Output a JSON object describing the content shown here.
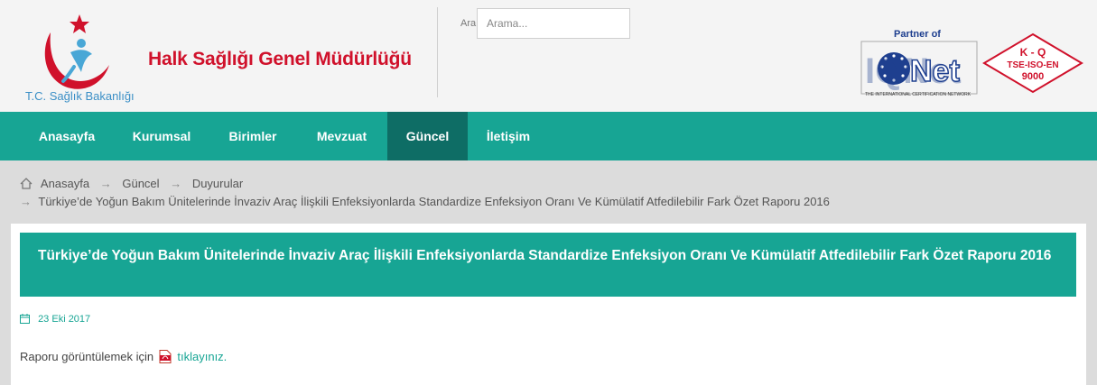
{
  "header": {
    "org_name": "Halk Sağlığı Genel Müdürlüğü",
    "ministry": "T.C. Sağlık Bakanlığı",
    "search": {
      "label": "Ara",
      "placeholder": "Arama..."
    },
    "badges": {
      "partner_label": "Partner of",
      "iqnet": "IQNet",
      "iqnet_sub": "THE INTERNATIONAL CERTIFICATION NETWORK",
      "kq_line1": "K - Q",
      "kq_line2": "TSE-ISO-EN",
      "kq_line3": "9000"
    },
    "colors": {
      "brand_red": "#d0112b",
      "teal": "#17a594",
      "teal_dark": "#0e6d65"
    }
  },
  "nav": {
    "items": [
      {
        "label": "Anasayfa"
      },
      {
        "label": "Kurumsal"
      },
      {
        "label": "Birimler"
      },
      {
        "label": "Mevzuat"
      },
      {
        "label": "Güncel",
        "active": true
      },
      {
        "label": "İletişim"
      }
    ]
  },
  "breadcrumb": {
    "items": [
      "Anasayfa",
      "Güncel",
      "Duyurular"
    ],
    "current": "Türkiye’de Yoğun Bakım Ünitelerinde İnvaziv Araç İlişkili Enfeksiyonlarda Standardize Enfeksiyon Oranı Ve Kümülatif Atfedilebilir Fark Özet Raporu 2016",
    "separator": "→"
  },
  "article": {
    "title": "Türkiye’de Yoğun Bakım Ünitelerinde İnvaziv Araç İlişkili Enfeksiyonlarda Standardize Enfeksiyon Oranı Ve Kümülatif Atfedilebilir Fark Özet Raporu 2016",
    "date": "23 Eki 2017",
    "body_text": "Raporu görüntülemek için",
    "link_text": "tıklayınız."
  }
}
